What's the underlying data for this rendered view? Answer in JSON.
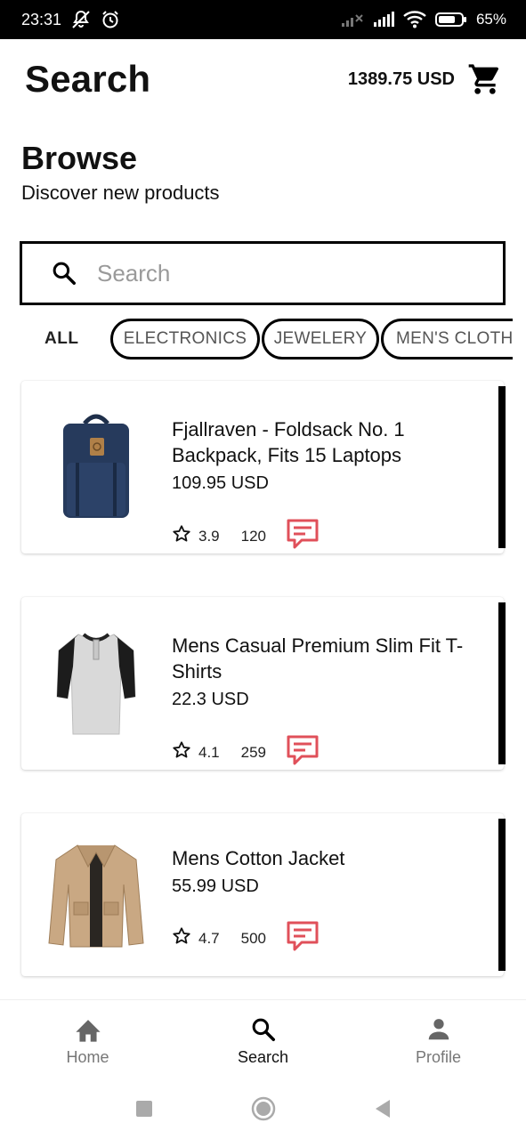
{
  "status_bar": {
    "time": "23:31",
    "battery": "65%"
  },
  "header": {
    "title": "Search",
    "balance": "1389.75 USD"
  },
  "browse": {
    "title": "Browse",
    "subtitle": "Discover new products"
  },
  "search": {
    "placeholder": "Search",
    "value": ""
  },
  "categories": [
    "ALL",
    "ELECTRONICS",
    "JEWELERY",
    "MEN'S CLOTHING"
  ],
  "products": [
    {
      "title": "Fjallraven - Foldsack No. 1 Backpack, Fits 15 Laptops",
      "price": "109.95 USD",
      "rating": "3.9",
      "count": "120",
      "image_icon": "backpack"
    },
    {
      "title": "Mens Casual Premium Slim Fit T-Shirts",
      "price": "22.3 USD",
      "rating": "4.1",
      "count": "259",
      "image_icon": "t-shirt"
    },
    {
      "title": "Mens Cotton Jacket",
      "price": "55.99 USD",
      "rating": "4.7",
      "count": "500",
      "image_icon": "jacket"
    }
  ],
  "bottom_nav": [
    {
      "label": "Home",
      "icon": "home-icon"
    },
    {
      "label": "Search",
      "icon": "search-icon"
    },
    {
      "label": "Profile",
      "icon": "person-icon"
    }
  ],
  "colors": {
    "accent": "#000000",
    "comment_icon": "#e0505a",
    "muted_text": "#777777"
  }
}
